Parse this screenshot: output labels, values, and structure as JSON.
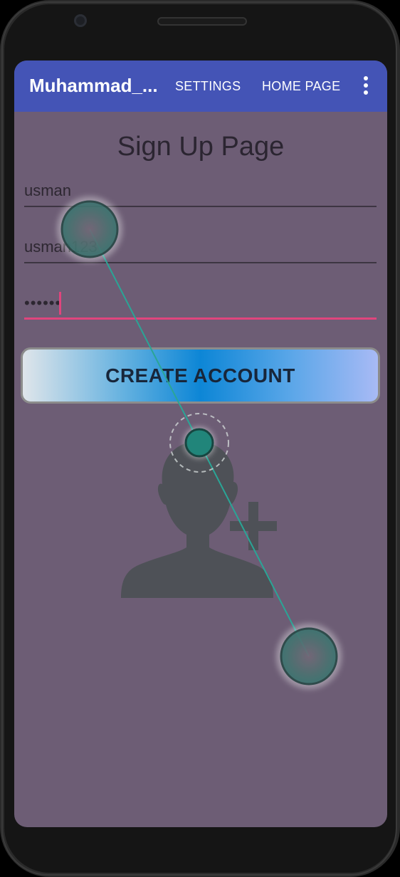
{
  "appbar": {
    "title": "Muhammad_...",
    "settings_label": "SETTINGS",
    "home_label": "HOME PAGE",
    "overflow_icon": "more-vert-icon",
    "color": "#4454b6"
  },
  "signup": {
    "heading": "Sign Up Page",
    "username_value": "usman",
    "email_value": "usman123",
    "password_value": "••••••",
    "create_button_label": "CREATE ACCOUNT",
    "illustration_icon": "add-user-icon"
  },
  "colors": {
    "background": "#6d5d75",
    "focus_accent": "#e0457d",
    "touch_indicator": "#21857a"
  }
}
